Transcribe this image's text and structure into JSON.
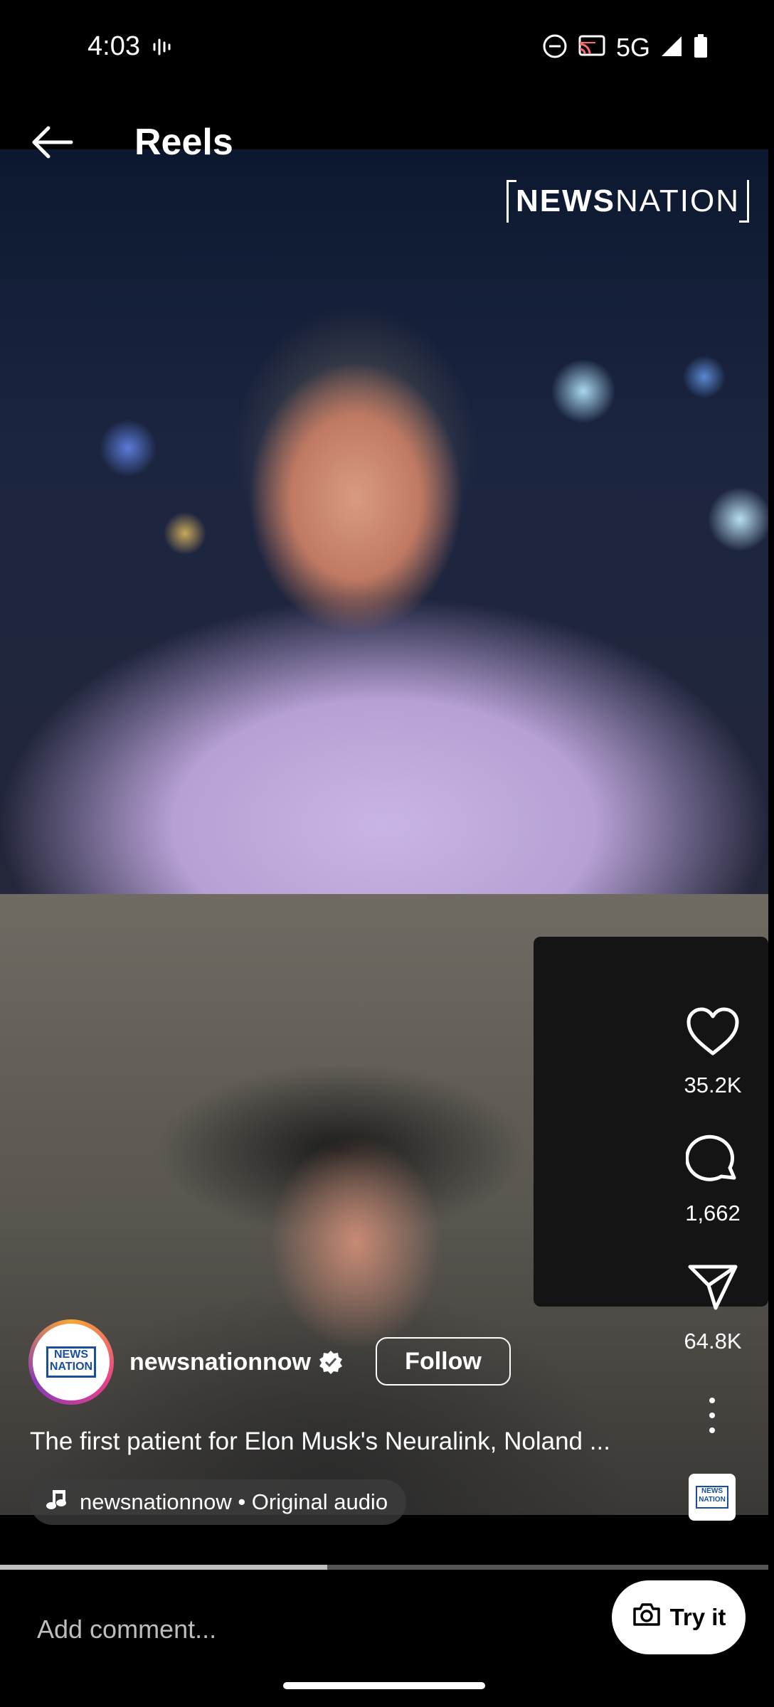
{
  "status_bar": {
    "time": "4:03",
    "network": "5G"
  },
  "header": {
    "title": "Reels"
  },
  "video_overlay": {
    "logo_bold": "NEWS",
    "logo_regular": "NATION"
  },
  "actions": {
    "likes": "35.2K",
    "comments": "1,662",
    "shares": "64.8K"
  },
  "post": {
    "username": "newsnationnow",
    "avatar_text_top": "NEWS",
    "avatar_text_bottom": "NATION",
    "follow_label": "Follow",
    "caption": "The first patient for Elon Musk's Neuralink, Noland ...",
    "audio": "newsnationnow • Original audio"
  },
  "progress": {
    "fraction": 0.426
  },
  "comment_bar": {
    "placeholder": "Add comment...",
    "try_label": "Try it"
  },
  "colors": {
    "background": "#000000",
    "accent_ring": "#e83f8b",
    "brand_blue": "#1a4fa0"
  }
}
